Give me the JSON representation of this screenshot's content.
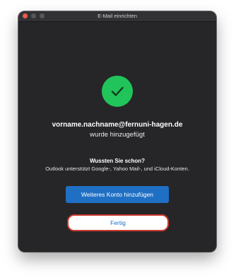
{
  "window": {
    "title": "E-Mail einrichten"
  },
  "status": {
    "icon": "checkmark-icon",
    "email": "vorname.nachname@fernuni-hagen.de",
    "message": "wurde hinzugefügt"
  },
  "tip": {
    "title": "Wussten Sie schon?",
    "text": "Outlook unterstützt Google-, Yahoo Mail-, und iCloud-Konten."
  },
  "buttons": {
    "add_account": "Weiteres Konto hinzufügen",
    "done": "Fertig"
  },
  "colors": {
    "window_bg": "#262628",
    "success_green": "#21c45a",
    "primary_blue": "#1f6fc4",
    "highlight_red": "#c93a2e"
  }
}
